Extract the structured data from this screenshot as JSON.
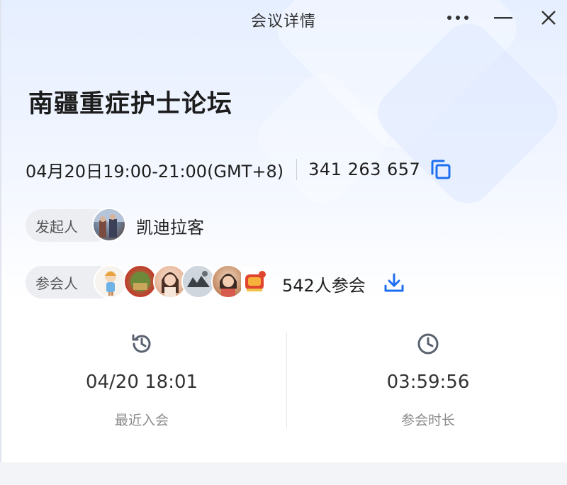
{
  "window": {
    "title": "会议详情"
  },
  "controls": {
    "more_icon": "more-icon",
    "minimize_icon": "minimize-icon",
    "close_icon": "close-icon"
  },
  "meeting": {
    "title": "南疆重症护士论坛",
    "time": "04月20日19:00-21:00(GMT+8)",
    "id": "341 263 657",
    "copy_icon": "copy-icon"
  },
  "host": {
    "tag": "发起人",
    "name": "凯迪拉客",
    "avatar_icon": "avatar"
  },
  "participants": {
    "tag": "参会人",
    "count_text": "542人参会",
    "download_icon": "download-icon",
    "avatars": [
      "avatar-1",
      "avatar-2",
      "avatar-3",
      "avatar-4",
      "avatar-5",
      "avatar-6"
    ]
  },
  "stats": [
    {
      "icon": "history-icon",
      "value": "04/20 18:01",
      "label": "最近入会"
    },
    {
      "icon": "clock-icon",
      "value": "03:59:56",
      "label": "参会时长"
    }
  ],
  "colors": {
    "accent": "#1e6ff0",
    "icon_gray": "#5a6170"
  }
}
